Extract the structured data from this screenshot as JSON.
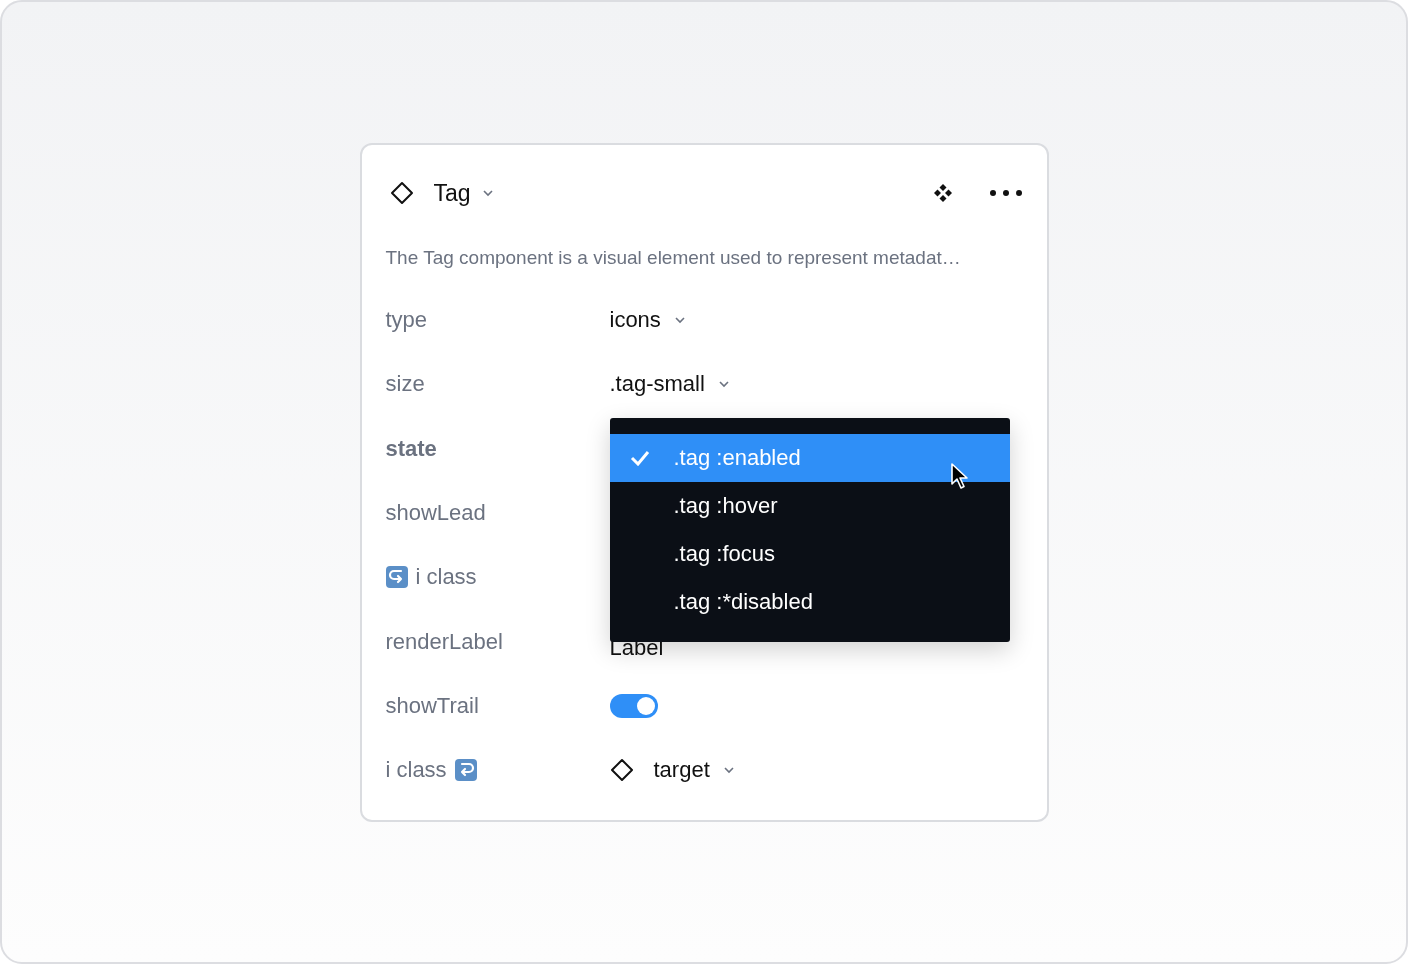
{
  "panel": {
    "title": "Tag",
    "description": "The Tag component is a visual element used to represent metadat…"
  },
  "properties": [
    {
      "label": "type",
      "kind": "select",
      "value": "icons",
      "active": false
    },
    {
      "label": "size",
      "kind": "select",
      "value": ".tag-small",
      "active": false
    },
    {
      "label": "state",
      "kind": "none",
      "active": true
    },
    {
      "label": "showLead",
      "kind": "none",
      "active": false
    },
    {
      "label": "i class",
      "kind": "none",
      "active": false
    },
    {
      "label": "renderLabel",
      "kind": "text",
      "value": "Label",
      "active": false
    },
    {
      "label": "showTrail",
      "kind": "toggle",
      "on": true,
      "active": false
    },
    {
      "label": "i class",
      "kind": "instance",
      "value": "target",
      "active": false
    }
  ],
  "menu": {
    "items": [
      {
        "label": ".tag :enabled",
        "selected": true
      },
      {
        "label": ".tag :hover",
        "selected": false
      },
      {
        "label": ".tag :focus",
        "selected": false
      },
      {
        "label": ".tag :*disabled",
        "selected": false
      }
    ]
  }
}
